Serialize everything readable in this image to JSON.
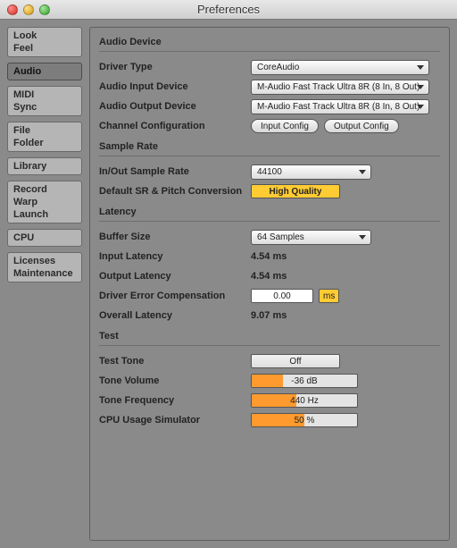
{
  "window": {
    "title": "Preferences"
  },
  "sidebar": {
    "groups": [
      {
        "items": [
          "Look",
          "Feel"
        ],
        "active": false
      },
      {
        "items": [
          "Audio"
        ],
        "active": true
      },
      {
        "items": [
          "MIDI",
          "Sync"
        ],
        "active": false
      },
      {
        "items": [
          "File",
          "Folder"
        ],
        "active": false
      },
      {
        "items": [
          "Library"
        ],
        "active": false
      },
      {
        "items": [
          "Record",
          "Warp",
          "Launch"
        ],
        "active": false
      },
      {
        "items": [
          "CPU"
        ],
        "active": false
      },
      {
        "items": [
          "Licenses",
          "Maintenance"
        ],
        "active": false
      }
    ]
  },
  "sections": {
    "audio_device": {
      "title": "Audio Device",
      "driver_type_label": "Driver Type",
      "driver_type_value": "CoreAudio",
      "input_device_label": "Audio Input Device",
      "input_device_value": "M-Audio Fast Track Ultra 8R (8 In, 8 Out)",
      "output_device_label": "Audio Output Device",
      "output_device_value": "M-Audio Fast Track Ultra 8R (8 In, 8 Out)",
      "channel_config_label": "Channel Configuration",
      "input_config_btn": "Input Config",
      "output_config_btn": "Output Config"
    },
    "sample_rate": {
      "title": "Sample Rate",
      "inout_label": "In/Out Sample Rate",
      "inout_value": "44100",
      "default_sr_label": "Default SR & Pitch Conversion",
      "default_sr_value": "High Quality"
    },
    "latency": {
      "title": "Latency",
      "buffer_label": "Buffer Size",
      "buffer_value": "64 Samples",
      "input_lat_label": "Input Latency",
      "input_lat_value": "4.54 ms",
      "output_lat_label": "Output Latency",
      "output_lat_value": "4.54 ms",
      "error_comp_label": "Driver Error Compensation",
      "error_comp_value": "0.00",
      "error_comp_unit": "ms",
      "overall_label": "Overall Latency",
      "overall_value": "9.07 ms"
    },
    "test": {
      "title": "Test",
      "tone_label": "Test Tone",
      "tone_value": "Off",
      "volume_label": "Tone Volume",
      "volume_value": "-36 dB",
      "volume_fill_pct": 30,
      "freq_label": "Tone Frequency",
      "freq_value": "440 Hz",
      "freq_fill_pct": 42,
      "cpu_label": "CPU Usage Simulator",
      "cpu_value": "50 %",
      "cpu_fill_pct": 50
    }
  }
}
